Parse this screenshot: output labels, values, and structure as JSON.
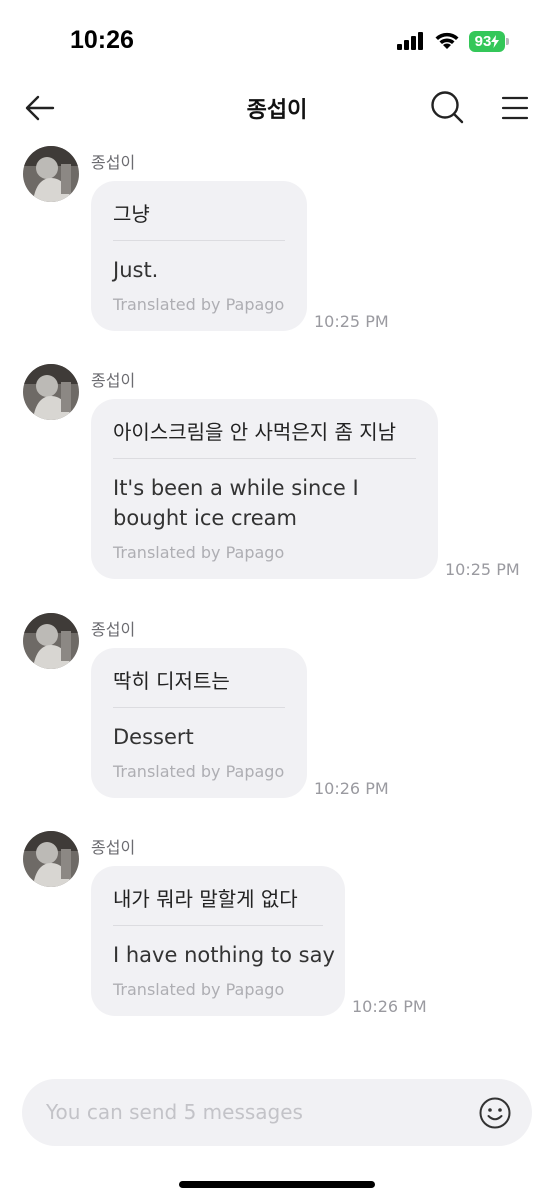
{
  "status_bar": {
    "time": "10:26",
    "battery": "93"
  },
  "header": {
    "title": "종섭이"
  },
  "messages": [
    {
      "sender": "종섭이",
      "original": "그냥",
      "translation": "Just.",
      "credit": "Translated by Papago",
      "time": "10:25 PM"
    },
    {
      "sender": "종섭이",
      "original": "아이스크림을 안 사먹은지 좀 지남",
      "translation_lines": [
        "It's been a while since I",
        "bought ice cream"
      ],
      "credit": "Translated by Papago",
      "time": "10:25 PM"
    },
    {
      "sender": "종섭이",
      "original": "딱히 디저트는",
      "translation": "Dessert",
      "credit": "Translated by Papago",
      "time": "10:26 PM"
    },
    {
      "sender": "종섭이",
      "original": "내가 뭐라 말할게 없다",
      "translation": "I have nothing to say",
      "credit": "Translated by Papago",
      "time": "10:26 PM"
    }
  ],
  "composer": {
    "placeholder": "You can send 5 messages"
  },
  "icons": {
    "back": "arrow-left-icon",
    "search": "search-icon",
    "menu": "hamburger-menu-icon",
    "emoji": "smiley-icon"
  },
  "colors": {
    "battery": "#34c759",
    "bubble": "#f1f1f4",
    "background": "#ffffff"
  }
}
